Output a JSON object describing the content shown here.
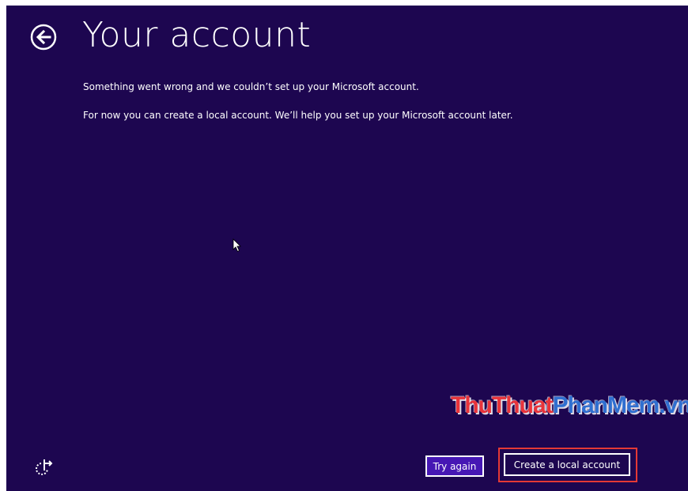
{
  "page": {
    "title": "Your account",
    "message_line1": "Something went wrong and we couldn’t set up your Microsoft account.",
    "message_line2": "For now you can create a local account. We’ll help you set up your Microsoft account later."
  },
  "buttons": {
    "back_icon": "back-arrow-icon",
    "try_again": "Try again",
    "create_local": "Create a local account"
  },
  "footer": {
    "ease_of_access_icon": "ease-of-access-icon"
  },
  "watermark": {
    "part1": "ThuThuat",
    "part2": "PhanMem",
    "part3": ".vn"
  },
  "colors": {
    "background": "#1d0650",
    "accent_button": "#4617b4",
    "text": "#ffffff",
    "highlight": "#e53935"
  }
}
